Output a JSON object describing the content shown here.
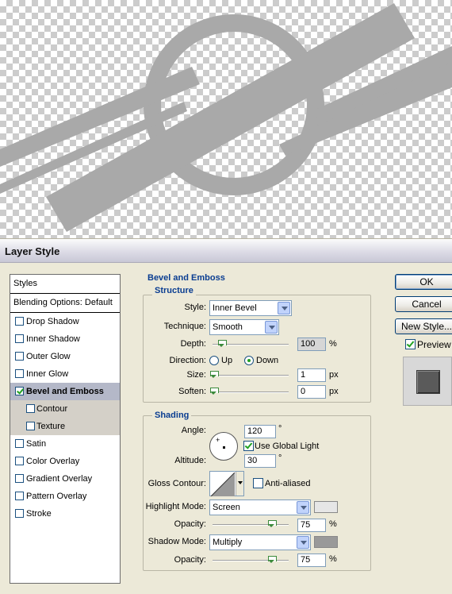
{
  "dialog": {
    "title": "Layer Style"
  },
  "style_list": {
    "header": "Styles",
    "blending": "Blending Options: Default",
    "items": [
      {
        "label": "Drop Shadow",
        "checked": false
      },
      {
        "label": "Inner Shadow",
        "checked": false
      },
      {
        "label": "Outer Glow",
        "checked": false
      },
      {
        "label": "Inner Glow",
        "checked": false
      },
      {
        "label": "Bevel and Emboss",
        "checked": true,
        "selected": true
      },
      {
        "label": "Contour",
        "checked": false,
        "sub": true
      },
      {
        "label": "Texture",
        "checked": false,
        "sub": true
      },
      {
        "label": "Satin",
        "checked": false
      },
      {
        "label": "Color Overlay",
        "checked": false
      },
      {
        "label": "Gradient Overlay",
        "checked": false
      },
      {
        "label": "Pattern Overlay",
        "checked": false
      },
      {
        "label": "Stroke",
        "checked": false
      }
    ]
  },
  "bevel": {
    "section_title": "Bevel and Emboss",
    "structure_title": "Structure",
    "style_label": "Style:",
    "style_value": "Inner Bevel",
    "technique_label": "Technique:",
    "technique_value": "Smooth",
    "depth_label": "Depth:",
    "depth_value": "100",
    "depth_unit": "%",
    "direction_label": "Direction:",
    "direction_up": "Up",
    "direction_down": "Down",
    "direction_selected": "Down",
    "size_label": "Size:",
    "size_value": "1",
    "size_unit": "px",
    "soften_label": "Soften:",
    "soften_value": "0",
    "soften_unit": "px"
  },
  "shading": {
    "title": "Shading",
    "angle_label": "Angle:",
    "angle_value": "120",
    "angle_unit": "°",
    "global_light_label": "Use Global Light",
    "global_light_checked": true,
    "altitude_label": "Altitude:",
    "altitude_value": "30",
    "altitude_unit": "°",
    "gloss_label": "Gloss Contour:",
    "anti_aliased_label": "Anti-aliased",
    "anti_aliased_checked": false,
    "highlight_label": "Highlight Mode:",
    "highlight_value": "Screen",
    "highlight_color": "#e6e6e6",
    "highlight_opacity_label": "Opacity:",
    "highlight_opacity_value": "75",
    "highlight_opacity_unit": "%",
    "shadow_label": "Shadow Mode:",
    "shadow_value": "Multiply",
    "shadow_color": "#999999",
    "shadow_opacity_label": "Opacity:",
    "shadow_opacity_value": "75",
    "shadow_opacity_unit": "%"
  },
  "buttons": {
    "ok": "OK",
    "cancel": "Cancel",
    "new_style": "New Style...",
    "preview_label": "Preview",
    "preview_checked": true
  },
  "colors": {
    "shape_fill": "#a9a9a9",
    "section_title": "#0a3d91",
    "preview_swatch": "#5a5a5a"
  }
}
